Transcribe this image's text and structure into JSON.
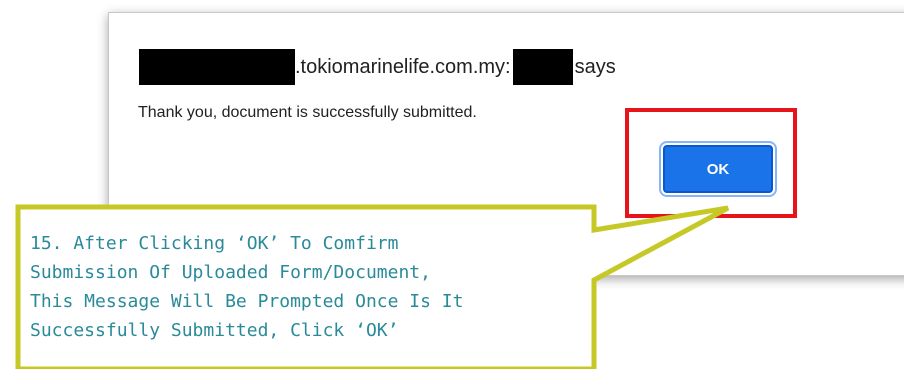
{
  "dialog": {
    "title_host": ".tokiomarinelife.com.my:",
    "title_suffix": "says",
    "message": "Thank you, document is successfully submitted.",
    "ok_label": "OK"
  },
  "annotation": {
    "lines": [
      "15. After Clicking ‘OK’ To Comfirm",
      "Submission Of Uploaded Form/Document,",
      "This Message Will Be Prompted Once Is It",
      "Successfully Submitted, Click ‘OK’"
    ]
  },
  "colors": {
    "callout_border": "#c6c925",
    "callout_text": "#2a8a9a",
    "highlight": "#e8141b",
    "button": "#1a73e8"
  }
}
